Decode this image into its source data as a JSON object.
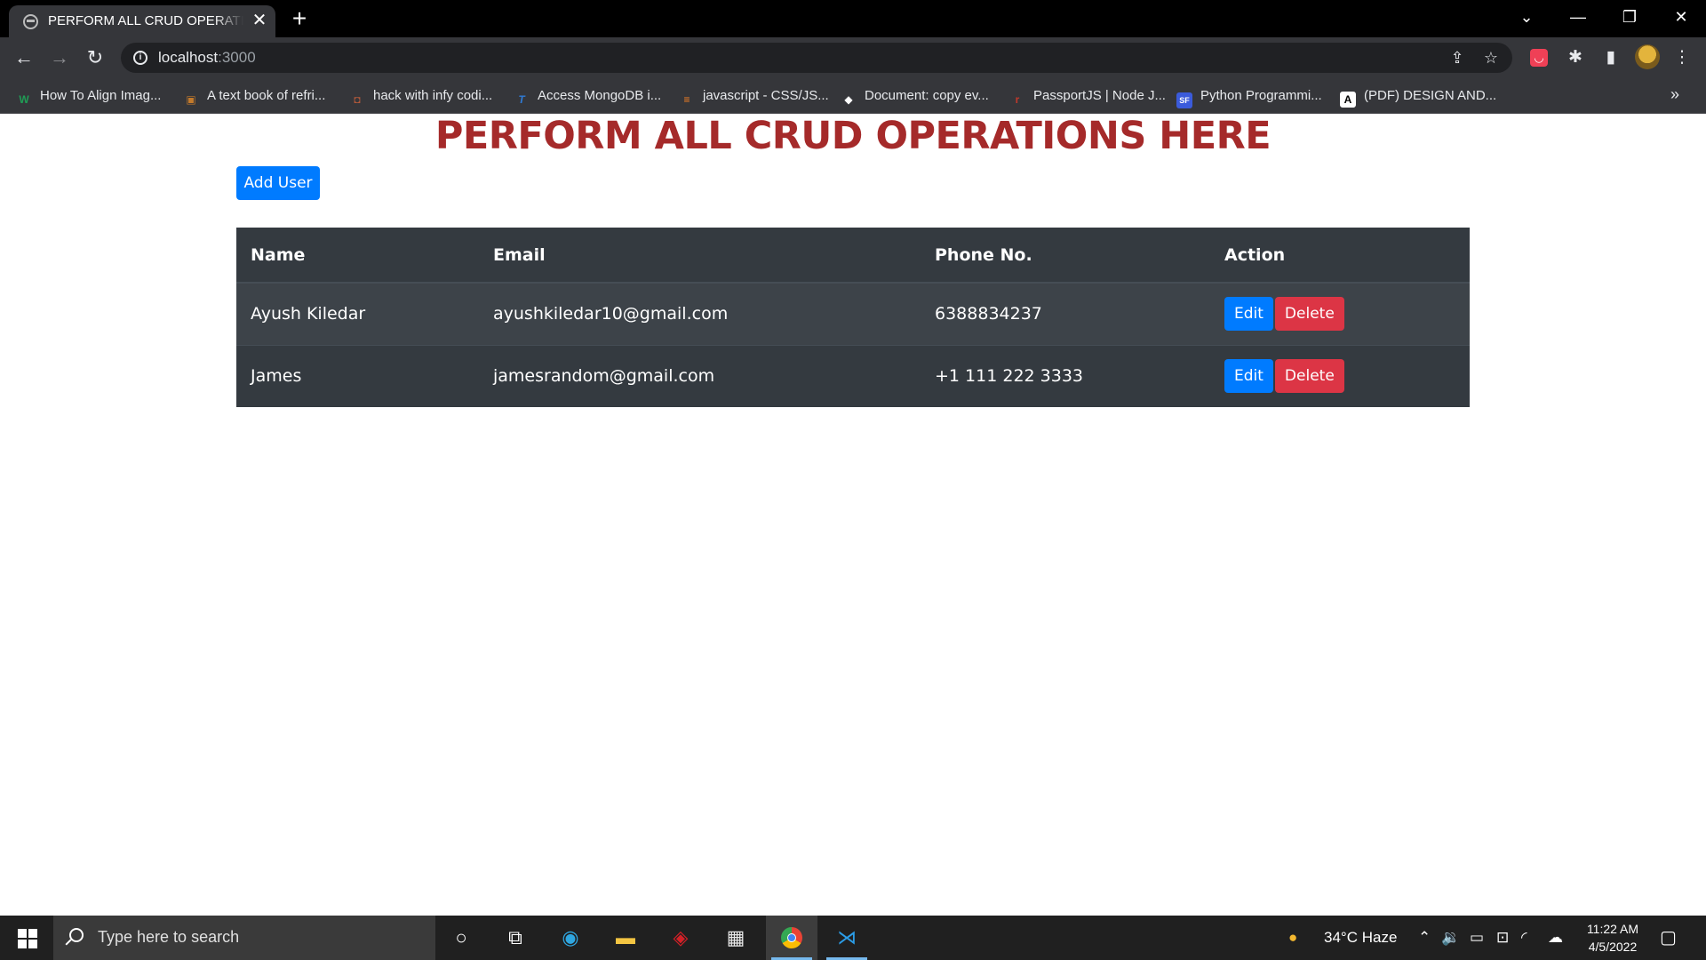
{
  "browser": {
    "tab_title": "PERFORM ALL CRUD OPERATIONS HERE",
    "tab_close": "✕",
    "new_tab": "+",
    "url_host": "localhost",
    "url_port": ":3000"
  },
  "bookmarks": [
    {
      "label": "How To Align Imag...",
      "icon_text": "W",
      "icon_color": "#1f9d55"
    },
    {
      "label": "A text book of refri...",
      "icon_text": "▣",
      "icon_color": "#c27a2c"
    },
    {
      "label": "hack with infy codi...",
      "icon_text": "◘",
      "icon_color": "#b0583a"
    },
    {
      "label": "Access MongoDB i...",
      "icon_text": "T",
      "icon_color": "#2f7bd6"
    },
    {
      "label": "javascript - CSS/JS...",
      "icon_text": "≡",
      "icon_color": "#f48024"
    },
    {
      "label": "Document: copy ev...",
      "icon_text": "◆",
      "icon_color": "#ffffff"
    },
    {
      "label": "PassportJS | Node J...",
      "icon_text": "r",
      "icon_color": "#c0392b"
    },
    {
      "label": "Python Programmi...",
      "icon_text": "SF",
      "icon_color": "#3b5bdb"
    },
    {
      "label": "(PDF) DESIGN AND...",
      "icon_text": "A",
      "icon_color": "#ffffff"
    }
  ],
  "page": {
    "title": "PERFORM ALL CRUD OPERATIONS HERE",
    "add_button": "Add User",
    "columns": [
      "Name",
      "Email",
      "Phone No.",
      "Action"
    ],
    "users": [
      {
        "name": "Ayush Kiledar",
        "email": "ayushkiledar10@gmail.com",
        "phone": "6388834237",
        "edit": "Edit",
        "delete": "Delete"
      },
      {
        "name": "James",
        "email": "jamesrandom@gmail.com",
        "phone": "+1 111 222 3333",
        "edit": "Edit",
        "delete": "Delete"
      }
    ]
  },
  "taskbar": {
    "search_placeholder": "Type here to search",
    "weather": "34°C  Haze",
    "time": "11:22 AM",
    "date": "4/5/2022"
  },
  "colors": {
    "title_red": "#a52a2a",
    "primary": "#007bff",
    "danger": "#dc3545",
    "table_dark": "#343a40"
  }
}
